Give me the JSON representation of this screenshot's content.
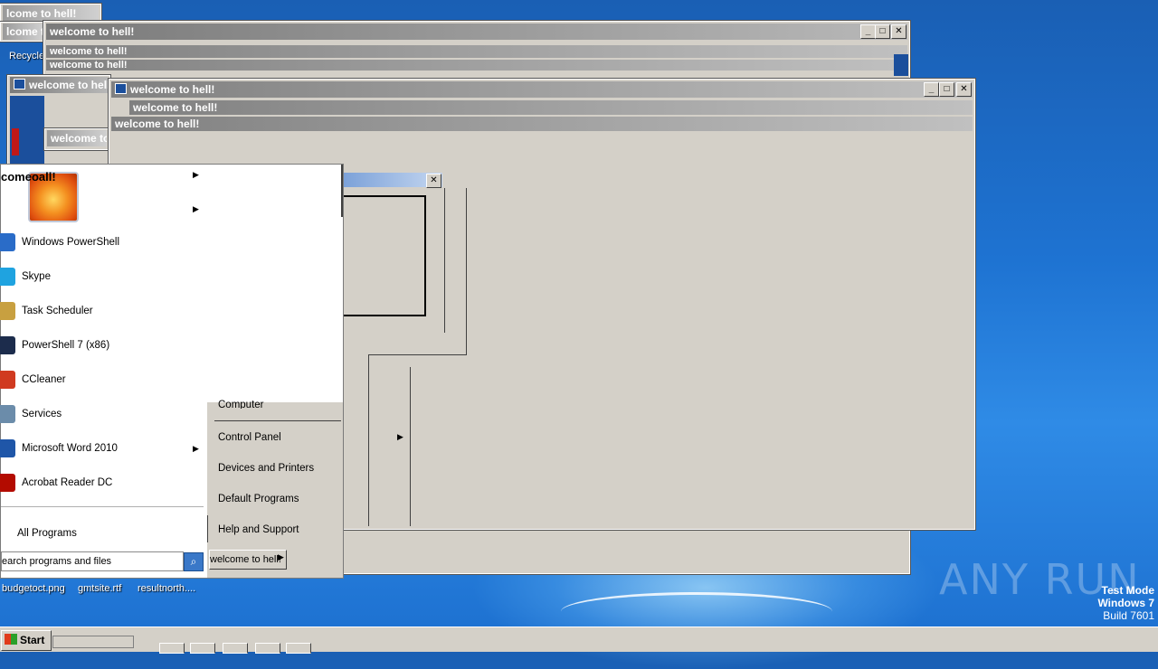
{
  "desktop": {
    "recycle_label": "Recycle",
    "files": [
      "budgetoct.png",
      "gmtsite.rtf",
      "resultnorth...."
    ],
    "watermark": "ANY RUN",
    "testmode": {
      "line1": "Test Mode",
      "line2": "Windows 7",
      "line3": "Build 7601"
    }
  },
  "windows": {
    "title": "welcome to hell!",
    "title_partial_a": "lcome to hell!",
    "title_partial_b": "welcome to",
    "title_partial_c": "welcome to hell!",
    "title_clipped": "comeoall!"
  },
  "start_menu": {
    "programs": [
      {
        "label": "Windows PowerShell",
        "icon": "powershell-icon",
        "color": "#2a6cc8",
        "arrow": false
      },
      {
        "label": "Skype",
        "icon": "skype-icon",
        "color": "#1fa3e0",
        "arrow": false
      },
      {
        "label": "Task Scheduler",
        "icon": "clock-icon",
        "color": "#c8a040",
        "arrow": false
      },
      {
        "label": "PowerShell 7 (x86)",
        "icon": "powershell7-icon",
        "color": "#1c2c4c",
        "arrow": false
      },
      {
        "label": "CCleaner",
        "icon": "ccleaner-icon",
        "color": "#d03a20",
        "arrow": false
      },
      {
        "label": "Services",
        "icon": "gears-icon",
        "color": "#6b8caa",
        "arrow": false
      },
      {
        "label": "Microsoft Word 2010",
        "icon": "word-icon",
        "color": "#1f56a8",
        "arrow": true
      },
      {
        "label": "Acrobat Reader DC",
        "icon": "acrobat-icon",
        "color": "#b30b00",
        "arrow": false
      }
    ],
    "all_programs": "All Programs",
    "search_placeholder": "earch programs and files",
    "right_links": [
      "Computer",
      "Control Panel",
      "Devices and Printers",
      "Default Programs",
      "Help and Support"
    ],
    "shutdown_label": "welcome to hell!"
  },
  "taskbar": {
    "start_label": "Start"
  },
  "colors": {
    "accent": "#1e73d2",
    "face": "#d4d0c8"
  }
}
